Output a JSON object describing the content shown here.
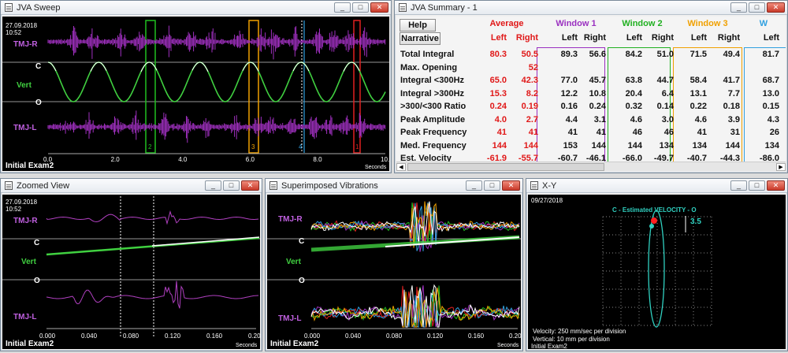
{
  "sweep": {
    "title": "JVA Sweep",
    "date": "27.09.2018",
    "time": "10:52",
    "label_r": "TMJ-R",
    "label_l": "TMJ-L",
    "label_c": "C",
    "label_vert": "Vert",
    "label_o": "O",
    "footer": "Initial Exam2",
    "unit": "Seconds",
    "ticks": [
      "0.0",
      "2.0",
      "4.0",
      "6.0",
      "8.0",
      "10.0"
    ],
    "markers": [
      "2",
      "3",
      "4",
      "1"
    ]
  },
  "summary": {
    "title": "JVA Summary - 1",
    "help": "Help",
    "narrative": "Narrative",
    "groups": [
      {
        "name": "Average",
        "color": "#e01818"
      },
      {
        "name": "Window 1",
        "color": "#9a30c0"
      },
      {
        "name": "Window 2",
        "color": "#20b020"
      },
      {
        "name": "Window 3",
        "color": "#f0a000"
      },
      {
        "name": "W",
        "color": "#30a0e0"
      }
    ],
    "sub": {
      "left": "Left",
      "right": "Right"
    },
    "rows": [
      {
        "label": "Total Integral",
        "values": [
          "80.3",
          "50.5",
          "89.3",
          "56.6",
          "84.2",
          "51.0",
          "71.5",
          "49.4",
          "81.7"
        ]
      },
      {
        "label": "Max. Opening",
        "values": [
          "",
          "52",
          "",
          "",
          "",
          "",
          "",
          "",
          ""
        ]
      },
      {
        "label": "Integral <300Hz",
        "values": [
          "65.0",
          "42.3",
          "77.0",
          "45.7",
          "63.8",
          "44.7",
          "58.4",
          "41.7",
          "68.7"
        ]
      },
      {
        "label": "Integral >300Hz",
        "values": [
          "15.3",
          "8.2",
          "12.2",
          "10.8",
          "20.4",
          "6.4",
          "13.1",
          "7.7",
          "13.0"
        ]
      },
      {
        "label": ">300/<300 Ratio",
        "values": [
          "0.24",
          "0.19",
          "0.16",
          "0.24",
          "0.32",
          "0.14",
          "0.22",
          "0.18",
          "0.15"
        ]
      },
      {
        "label": "Peak Amplitude",
        "values": [
          "4.0",
          "2.7",
          "4.4",
          "3.1",
          "4.6",
          "3.0",
          "4.6",
          "3.9",
          "4.3"
        ]
      },
      {
        "label": "Peak Frequency",
        "values": [
          "41",
          "41",
          "41",
          "41",
          "46",
          "46",
          "41",
          "31",
          "26"
        ]
      },
      {
        "label": "Med. Frequency",
        "values": [
          "144",
          "144",
          "153",
          "144",
          "144",
          "134",
          "134",
          "144",
          "134"
        ]
      },
      {
        "label": "Est. Velocity",
        "values": [
          "-61.9",
          "-55.7",
          "-60.7",
          "-46.1",
          "-66.0",
          "-49.7",
          "-40.7",
          "-44.3",
          "-86.0"
        ]
      }
    ]
  },
  "zoom": {
    "title": "Zoomed View",
    "date": "27.09.2018",
    "time": "10:52",
    "label_r": "TMJ-R",
    "label_l": "TMJ-L",
    "label_c": "C",
    "label_vert": "Vert",
    "label_o": "O",
    "footer": "Initial Exam2",
    "unit": "Seconds",
    "ticks": [
      "0.000",
      "0.040",
      "0.080",
      "0.120",
      "0.160",
      "0.200"
    ]
  },
  "superimposed": {
    "title": "Superimposed Vibrations",
    "label_r": "TMJ-R",
    "label_l": "TMJ-L",
    "label_c": "C",
    "label_vert": "Vert",
    "label_o": "O",
    "footer": "Initial Exam2",
    "unit": "Seconds",
    "ticks": [
      "0.000",
      "0.040",
      "0.080",
      "0.120",
      "0.160",
      "0.200"
    ]
  },
  "xy": {
    "title": "X-Y",
    "date": "09/27/2018",
    "heading": "C - Estimated VELOCITY - O",
    "value": "3.5",
    "vel_note": "Velocity: 250 mm/sec per division",
    "vert_note": "Vertical: 10 mm per division",
    "footer": "Initial Exam2"
  },
  "ctl": {
    "min": "_",
    "max": "□",
    "close": "✕"
  }
}
